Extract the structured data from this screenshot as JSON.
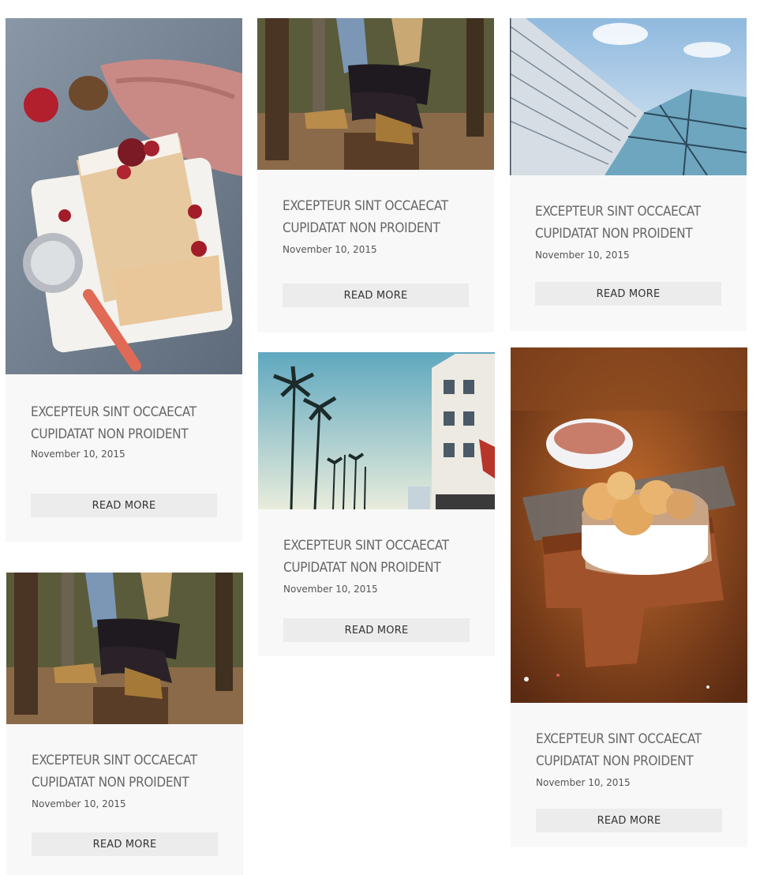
{
  "posts": [
    {
      "image": "cranberry-loaf-cake-photo",
      "title": "EXCEPTEUR SINT OCCAECAT CUPIDATAT NON PROIDENT",
      "date": "November 10, 2015",
      "read_more": "READ MORE"
    },
    {
      "image": "woman-sitting-on-stump-photo",
      "title": "EXCEPTEUR SINT OCCAECAT CUPIDATAT NON PROIDENT",
      "date": "November 10, 2015",
      "read_more": "READ MORE"
    },
    {
      "image": "glass-building-photo",
      "title": "EXCEPTEUR SINT OCCAECAT CUPIDATAT NON PROIDENT",
      "date": "November 10, 2015",
      "read_more": "READ MORE"
    },
    {
      "image": "palm-trees-street-photo",
      "title": "EXCEPTEUR SINT OCCAECAT CUPIDATAT NON PROIDENT",
      "date": "November 10, 2015",
      "read_more": "READ MORE"
    },
    {
      "image": "cookies-on-cutting-board-photo",
      "title": "EXCEPTEUR SINT OCCAECAT CUPIDATAT NON PROIDENT",
      "date": "November 10, 2015",
      "read_more": "READ MORE"
    },
    {
      "image": "woman-sitting-on-stump-photo",
      "title": "EXCEPTEUR SINT OCCAECAT CUPIDATAT NON PROIDENT",
      "date": "November 10, 2015",
      "read_more": "READ MORE"
    }
  ]
}
